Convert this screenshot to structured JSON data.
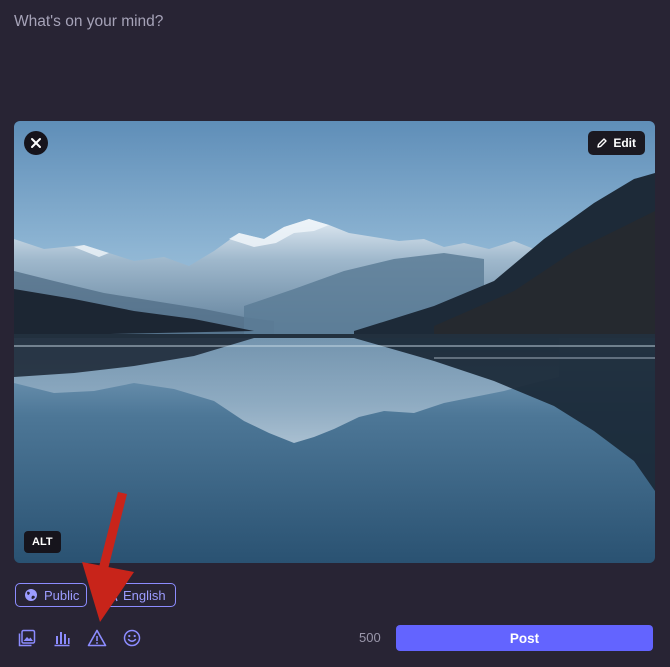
{
  "composer": {
    "placeholder": "What's on your mind?",
    "attachment": {
      "edit_label": "Edit",
      "alt_label": "ALT",
      "close_icon": "close-icon",
      "edit_icon": "pencil-icon"
    },
    "visibility_label": "Public",
    "language_label": "English",
    "toolbar": {
      "icons": [
        "media-icon",
        "poll-icon",
        "content-warning-icon",
        "emoji-icon"
      ]
    },
    "char_count": "500",
    "post_label": "Post"
  },
  "colors": {
    "background": "#282434",
    "accent": "#6364ff",
    "pill_border": "#8c8cff",
    "annotation_arrow": "#c8241a"
  }
}
